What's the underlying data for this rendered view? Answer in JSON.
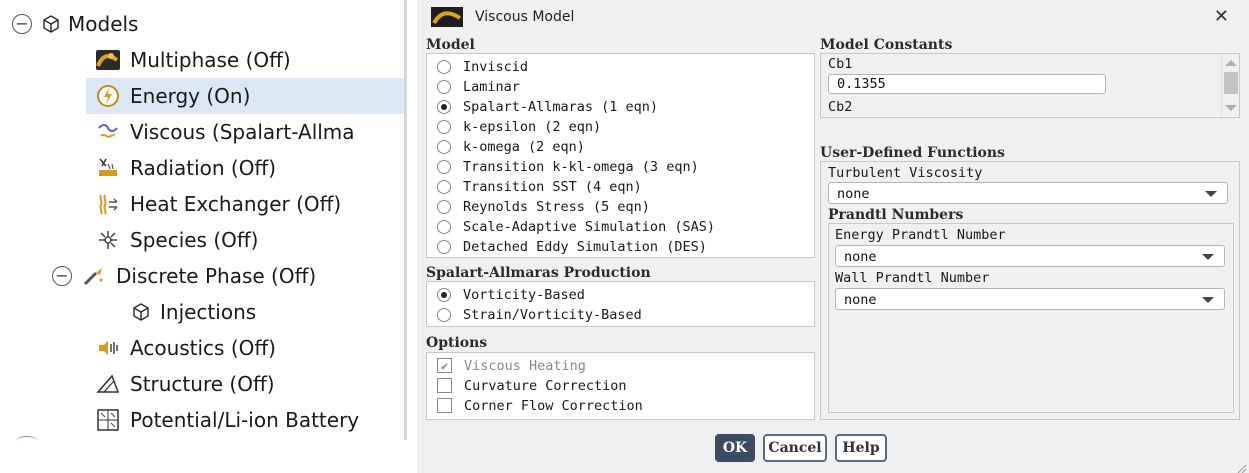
{
  "tree": {
    "root": {
      "label": "Models",
      "icon": "cube-icon"
    },
    "items": [
      {
        "label": "Multiphase (Off)",
        "icon": "multiphase-icon"
      },
      {
        "label": "Energy (On)",
        "icon": "energy-icon"
      },
      {
        "label": "Viscous (Spalart-Allma",
        "icon": "viscous-icon"
      },
      {
        "label": "Radiation (Off)",
        "icon": "radiation-icon"
      },
      {
        "label": "Heat Exchanger (Off)",
        "icon": "heat-exchanger-icon"
      },
      {
        "label": "Species (Off)",
        "icon": "species-icon"
      },
      {
        "label": "Discrete Phase (Off)",
        "icon": "discrete-phase-icon"
      },
      {
        "label": "Injections",
        "icon": "cube-icon"
      },
      {
        "label": "Acoustics (Off)",
        "icon": "acoustics-icon"
      },
      {
        "label": "Structure (Off)",
        "icon": "structure-icon"
      },
      {
        "label": "Potential/Li-ion Battery",
        "icon": "battery-icon"
      }
    ],
    "selected": "Energy (On)"
  },
  "dialog": {
    "title": "Viscous Model",
    "close_icon": "close-icon",
    "model": {
      "title": "Model",
      "options": [
        "Inviscid",
        "Laminar",
        "Spalart-Allmaras (1 eqn)",
        "k-epsilon (2 eqn)",
        "k-omega (2 eqn)",
        "Transition k-kl-omega (3 eqn)",
        "Transition SST (4 eqn)",
        "Reynolds Stress (5 eqn)",
        "Scale-Adaptive Simulation (SAS)",
        "Detached Eddy Simulation (DES)"
      ],
      "selected": "Spalart-Allmaras (1 eqn)"
    },
    "production": {
      "title": "Spalart-Allmaras Production",
      "options": [
        "Vorticity-Based",
        "Strain/Vorticity-Based"
      ],
      "selected": "Vorticity-Based"
    },
    "options": {
      "title": "Options",
      "items": [
        {
          "label": "Viscous Heating",
          "checked": true,
          "disabled": true
        },
        {
          "label": "Curvature Correction",
          "checked": false,
          "disabled": false
        },
        {
          "label": "Corner Flow Correction",
          "checked": false,
          "disabled": false
        }
      ]
    },
    "constants": {
      "title": "Model Constants",
      "cb1_label": "Cb1",
      "cb1_value": "0.1355",
      "cb2_label": "Cb2"
    },
    "udf": {
      "title": "User-Defined Functions",
      "turbulent_viscosity_label": "Turbulent Viscosity",
      "turbulent_viscosity_value": "none",
      "prandtl_title": "Prandtl Numbers",
      "energy_prandtl_label": "Energy Prandtl Number",
      "energy_prandtl_value": "none",
      "wall_prandtl_label": "Wall Prandtl Number",
      "wall_prandtl_value": "none"
    },
    "buttons": {
      "ok": "OK",
      "cancel": "Cancel",
      "help": "Help"
    }
  }
}
